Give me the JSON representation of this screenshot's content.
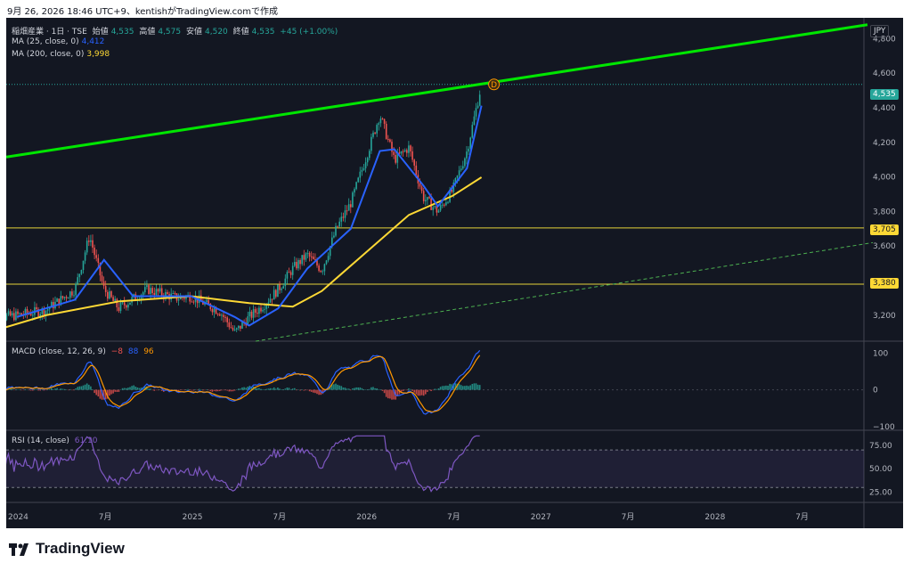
{
  "caption": "9月 26, 2026 18:46 UTC+9、kentishがTradingView.comで作成",
  "brand": "TradingView",
  "currency": "JPY",
  "price_header": {
    "symbol": "稲畑産業 · 1日 · TSE",
    "open_label": "始値",
    "open": "4,535",
    "high_label": "高値",
    "high": "4,575",
    "low_label": "安値",
    "low": "4,520",
    "close_label": "終値",
    "close": "4,535",
    "change": "+45 (+1.00%)"
  },
  "ma_legend": [
    {
      "label": "MA (25, close, 0)",
      "value": "4,412",
      "color": "#2962ff"
    },
    {
      "label": "MA (200, close, 0)",
      "value": "3,998",
      "color": "#fdd835"
    }
  ],
  "macd_legend": {
    "label": "MACD (close, 12, 26, 9)",
    "hist": "−8",
    "macd": "88",
    "signal": "96"
  },
  "rsi_legend": {
    "label": "RSI (14, close)",
    "value": "61.10"
  },
  "colors": {
    "up": "#26a69a",
    "down": "#ef5350",
    "ma25": "#2962ff",
    "ma200": "#fdd835",
    "trend": "#00e600",
    "rsi": "#7e57c2",
    "hline": "#e5d33a"
  },
  "chart_data": {
    "type": "candlestick",
    "x_ticks": [
      "2024",
      "7月",
      "2025",
      "7月",
      "2026",
      "7月",
      "2027",
      "7月",
      "2028",
      "7月"
    ],
    "y_ticks": [
      "4,800",
      "4,600",
      "4,400",
      "4,200",
      "4,000",
      "3,800",
      "3,600",
      "3,200"
    ],
    "ylim": [
      3050,
      4920
    ],
    "last_price": "4,535",
    "horizontal_levels": [
      {
        "value": 3705,
        "label": "3,705"
      },
      {
        "value": 3380,
        "label": "3,380"
      }
    ],
    "marker": "D",
    "price_path": [
      {
        "date": "2023-11",
        "close": 3180
      },
      {
        "date": "2024-01",
        "close": 3200
      },
      {
        "date": "2024-03",
        "close": 3230
      },
      {
        "date": "2024-05",
        "close": 3350
      },
      {
        "date": "2024-06",
        "close": 3660
      },
      {
        "date": "2024-07",
        "close": 3350
      },
      {
        "date": "2024-08",
        "close": 3240
      },
      {
        "date": "2024-10",
        "close": 3350
      },
      {
        "date": "2024-12",
        "close": 3300
      },
      {
        "date": "2025-01",
        "close": 3310
      },
      {
        "date": "2025-03",
        "close": 3220
      },
      {
        "date": "2025-04",
        "close": 3100
      },
      {
        "date": "2025-05",
        "close": 3190
      },
      {
        "date": "2025-06",
        "close": 3260
      },
      {
        "date": "2025-07",
        "close": 3350
      },
      {
        "date": "2025-08",
        "close": 3470
      },
      {
        "date": "2025-09",
        "close": 3550
      },
      {
        "date": "2025-10",
        "close": 3460
      },
      {
        "date": "2025-11",
        "close": 3700
      },
      {
        "date": "2025-12",
        "close": 3850
      },
      {
        "date": "2026-01",
        "close": 4100
      },
      {
        "date": "2026-02",
        "close": 4360
      },
      {
        "date": "2026-03",
        "close": 4100
      },
      {
        "date": "2026-04",
        "close": 4170
      },
      {
        "date": "2026-05",
        "close": 3880
      },
      {
        "date": "2026-06",
        "close": 3800
      },
      {
        "date": "2026-07",
        "close": 3920
      },
      {
        "date": "2026-08",
        "close": 4150
      },
      {
        "date": "2026-09",
        "close": 4535
      }
    ],
    "ma25": [
      {
        "date": "2024-01",
        "value": 3190
      },
      {
        "date": "2024-05",
        "value": 3290
      },
      {
        "date": "2024-07",
        "value": 3520
      },
      {
        "date": "2024-09",
        "value": 3310
      },
      {
        "date": "2025-01",
        "value": 3310
      },
      {
        "date": "2025-04",
        "value": 3190
      },
      {
        "date": "2025-05",
        "value": 3140
      },
      {
        "date": "2025-07",
        "value": 3240
      },
      {
        "date": "2025-09",
        "value": 3470
      },
      {
        "date": "2025-12",
        "value": 3700
      },
      {
        "date": "2026-02",
        "value": 4150
      },
      {
        "date": "2026-03",
        "value": 4160
      },
      {
        "date": "2026-05",
        "value": 3950
      },
      {
        "date": "2026-06",
        "value": 3830
      },
      {
        "date": "2026-08",
        "value": 4050
      },
      {
        "date": "2026-09",
        "value": 4412
      }
    ],
    "ma200": [
      {
        "date": "2023-11",
        "value": 3100
      },
      {
        "date": "2024-03",
        "value": 3200
      },
      {
        "date": "2024-08",
        "value": 3280
      },
      {
        "date": "2025-01",
        "value": 3310
      },
      {
        "date": "2025-05",
        "value": 3270
      },
      {
        "date": "2025-08",
        "value": 3250
      },
      {
        "date": "2025-10",
        "value": 3340
      },
      {
        "date": "2026-01",
        "value": 3560
      },
      {
        "date": "2026-04",
        "value": 3780
      },
      {
        "date": "2026-07",
        "value": 3890
      },
      {
        "date": "2026-09",
        "value": 3998
      }
    ],
    "macd": {
      "ylim": [
        -110,
        130
      ],
      "ticks": [
        "100",
        "0",
        "−100"
      ]
    },
    "rsi": {
      "ylim": [
        15,
        90
      ],
      "ticks": [
        "75.00",
        "50.00",
        "25.00"
      ],
      "band": [
        30,
        70
      ]
    }
  }
}
